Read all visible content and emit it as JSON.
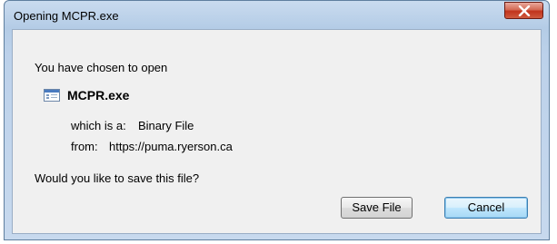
{
  "window": {
    "title": "Opening MCPR.exe"
  },
  "dialog": {
    "intro": "You have chosen to open",
    "file_name": "MCPR.exe",
    "type_label": "which is a:",
    "type_value": "Binary File",
    "from_label": "from:",
    "from_value": "https://puma.ryerson.ca",
    "question": "Would you like to save this file?"
  },
  "buttons": {
    "save": "Save File",
    "cancel": "Cancel"
  },
  "icons": {
    "file": "application-file-icon",
    "close": "close-x-icon"
  },
  "colors": {
    "close_button": "#c1331c",
    "frame": "#bcd1ea",
    "default_button_border": "#3c7fb1"
  }
}
